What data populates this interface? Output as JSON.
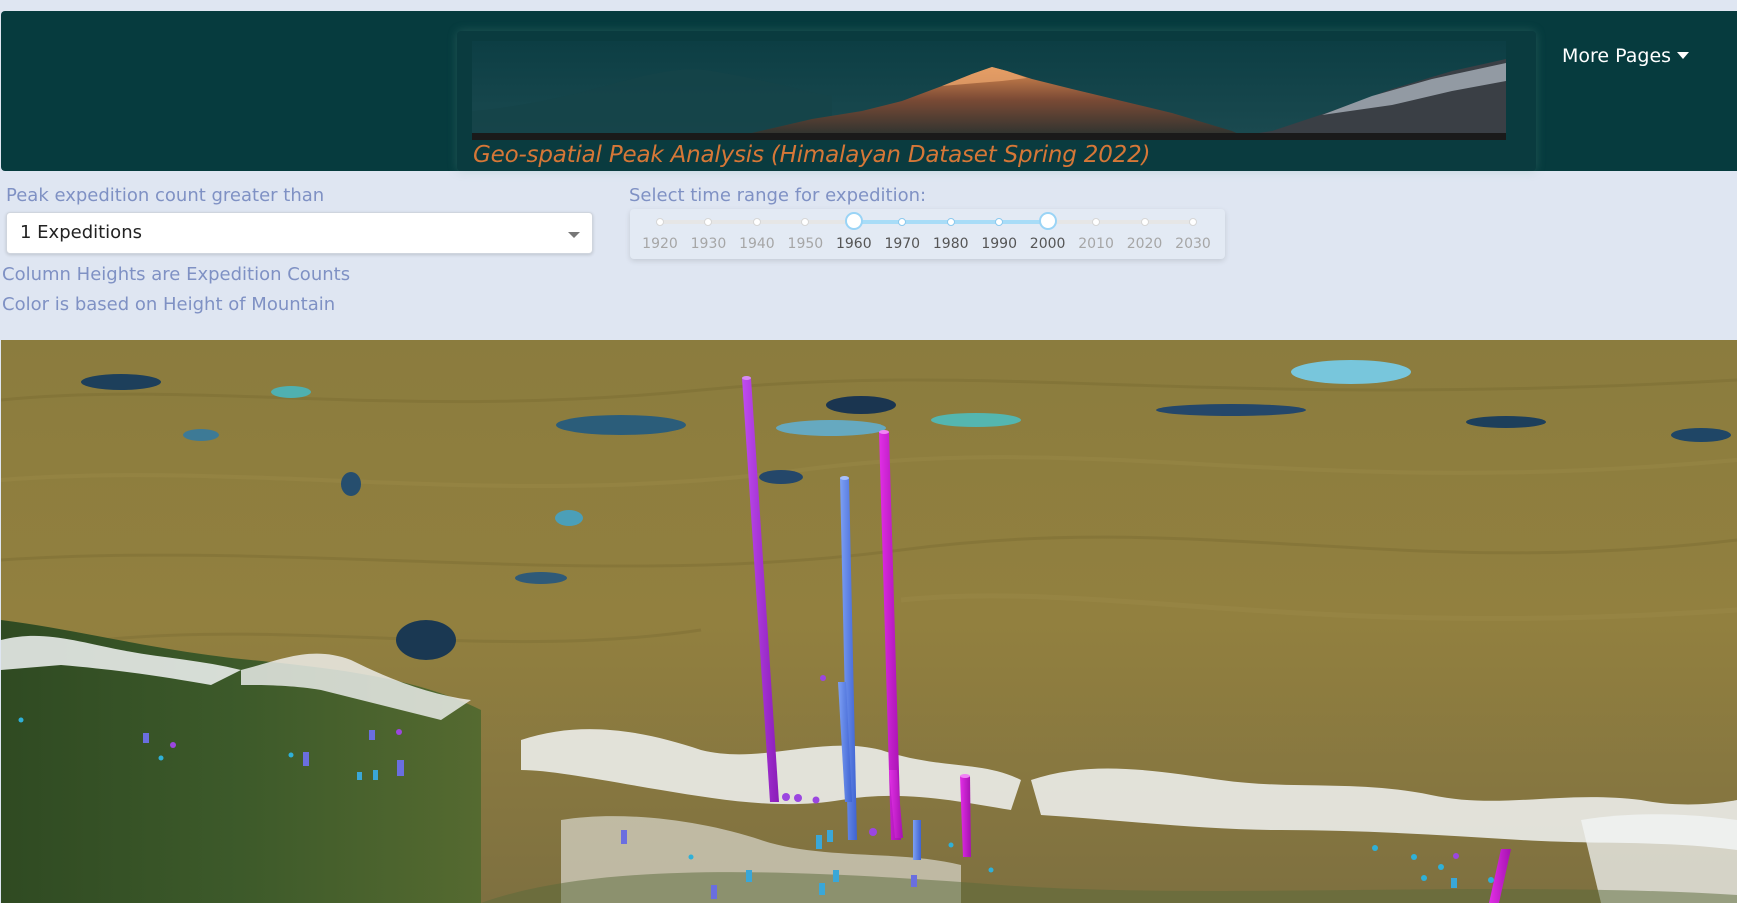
{
  "header": {
    "title": "Geo-spatial Peak Analysis (Himalayan Dataset Spring 2022)",
    "menu_label": "More Pages"
  },
  "controls": {
    "expedition_filter": {
      "label": "Peak expedition count greater than",
      "selected": "1 Expeditions"
    },
    "time_range": {
      "label": "Select time range for expedition:",
      "marks": [
        "1920",
        "1930",
        "1940",
        "1950",
        "1960",
        "1970",
        "1980",
        "1990",
        "2000",
        "2010",
        "2020",
        "2030"
      ],
      "selected_range": [
        1960,
        2000
      ]
    },
    "legend_lines": [
      "Column Heights are Expedition Counts",
      "Color is based on Height of Mountain"
    ]
  },
  "colors": {
    "header_bg": "#063b3e",
    "title": "#d67737",
    "label": "#7f91c4",
    "slider_active": "#a8dcf7",
    "column_tall": "#b02adf",
    "column_mid": "#5b80e8",
    "column_low": "#2fa8d8"
  },
  "icons": {
    "menu_caret": "chevron-down-icon",
    "select_caret": "chevron-down-icon"
  }
}
